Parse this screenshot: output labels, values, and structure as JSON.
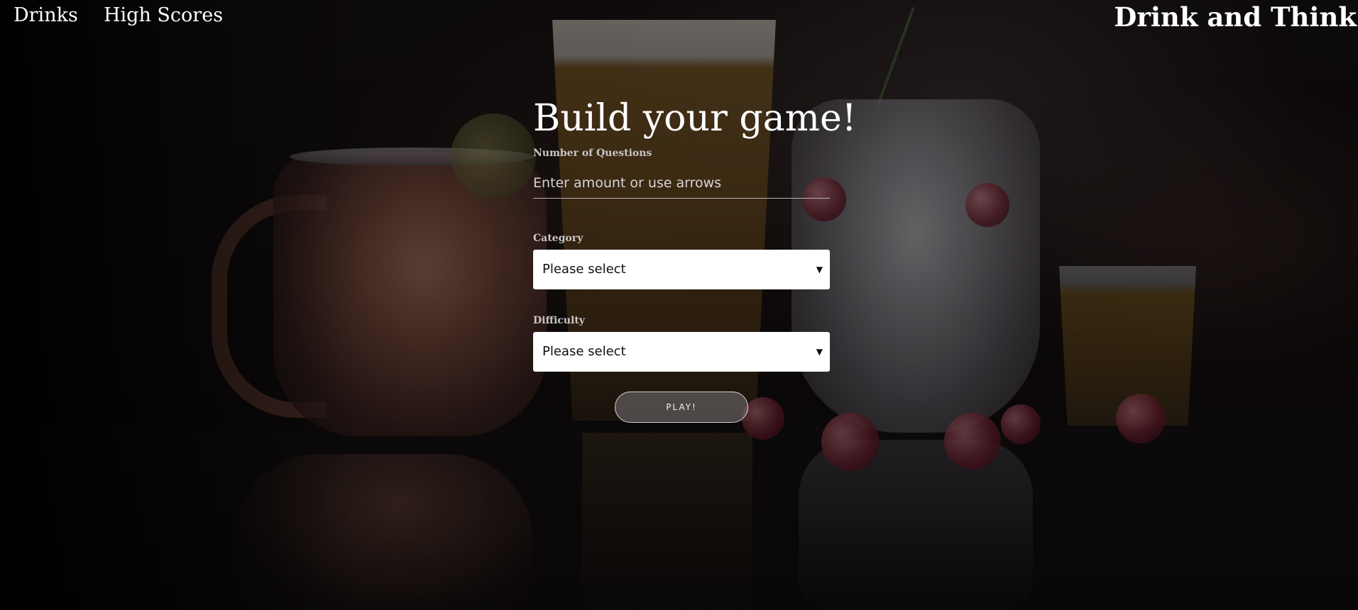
{
  "nav": {
    "drinks_label": "Drinks",
    "high_scores_label": "High Scores",
    "brand": "Drink and Think"
  },
  "form": {
    "title": "Build your game!",
    "questions": {
      "label": "Number of Questions",
      "placeholder": "Enter amount or use arrows"
    },
    "category": {
      "label": "Category",
      "selected": "Please select"
    },
    "difficulty": {
      "label": "Difficulty",
      "selected": "Please select"
    },
    "play_label": "PLAY!"
  },
  "icons": {
    "select_arrow": "▼"
  },
  "colors": {
    "text": "#ffffff",
    "label": "#c9c5c6",
    "select_bg": "#ffffff"
  }
}
